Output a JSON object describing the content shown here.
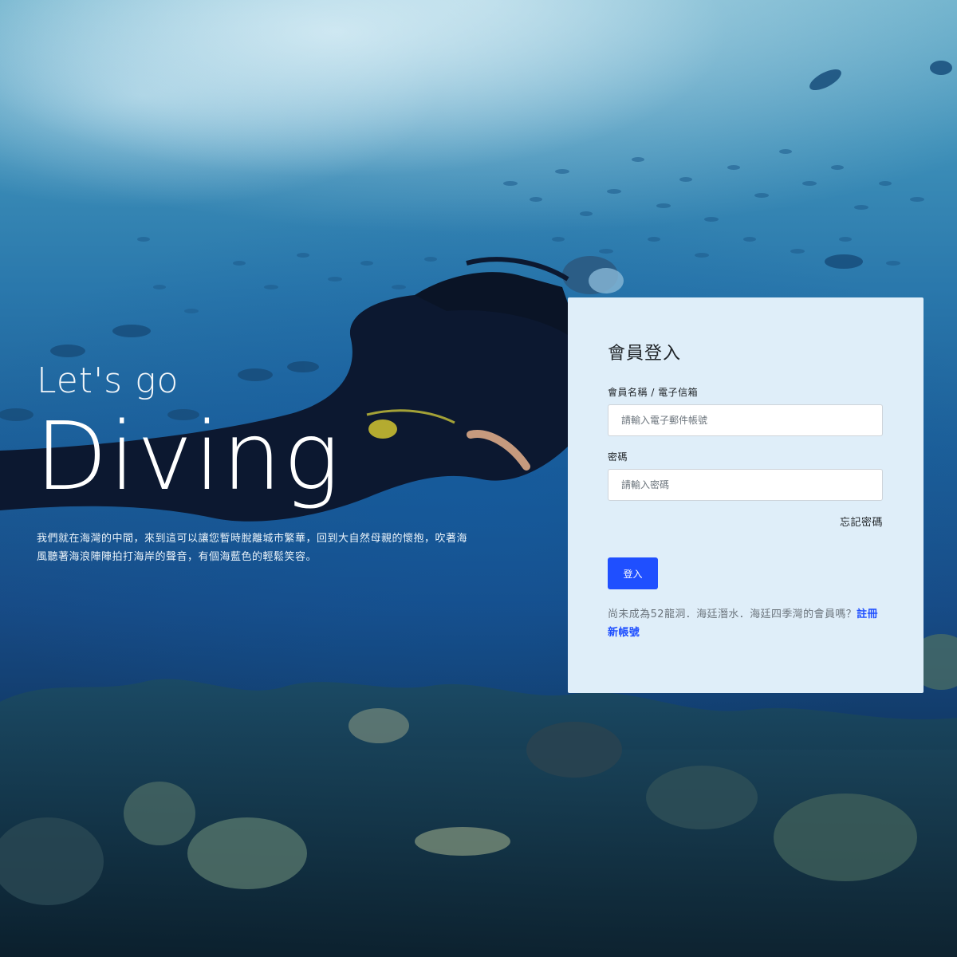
{
  "hero": {
    "tagline": "Let's go",
    "headline": "Diving",
    "description": "我們就在海灣的中間，來到這可以讓您暫時脫離城市繁華，回到大自然母親的懷抱，吹著海風聽著海浪陣陣拍打海岸的聲音，有個海藍色的輕鬆笑容。"
  },
  "login": {
    "title": "會員登入",
    "username_label": "會員名稱 / 電子信箱",
    "username_placeholder": "請輸入電子郵件帳號",
    "username_value": "",
    "password_label": "密碼",
    "password_placeholder": "請輸入密碼",
    "password_value": "",
    "forgot_label": "忘記密碼",
    "submit_label": "登入",
    "register_prompt": "尚未成為52龍洞．海廷潛水．海廷四季灣的會員嗎？",
    "register_link": "註冊新帳號"
  },
  "colors": {
    "accent": "#1f4fff",
    "card_background": "#dfeef9"
  }
}
